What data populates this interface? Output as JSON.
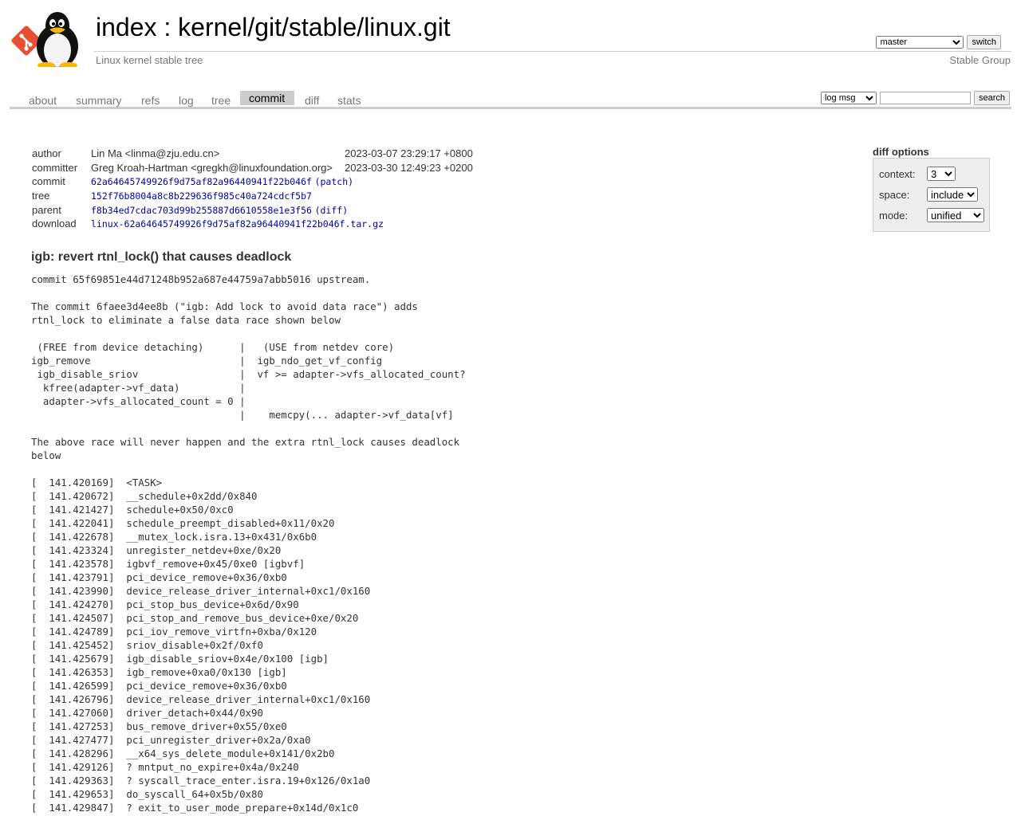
{
  "header": {
    "title_index": "index",
    "title_sep": ":",
    "title_repo": "kernel/git/stable/linux.git",
    "description": "Linux kernel stable tree",
    "owner": "Stable Group",
    "branch_options": [
      "master"
    ],
    "branch_selected": "master",
    "switch_label": "switch"
  },
  "tabs": [
    {
      "label": "about"
    },
    {
      "label": "summary"
    },
    {
      "label": "refs"
    },
    {
      "label": "log"
    },
    {
      "label": "tree"
    },
    {
      "label": "commit",
      "active": true
    },
    {
      "label": "diff"
    },
    {
      "label": "stats"
    }
  ],
  "search": {
    "mode_options": [
      "log msg"
    ],
    "mode_selected": "log msg",
    "query": "",
    "button_label": "search"
  },
  "commit_info": {
    "author_label": "author",
    "author": "Lin Ma <linma@zju.edu.cn>",
    "author_date": "2023-03-07 23:29:17 +0800",
    "committer_label": "committer",
    "committer": "Greg Kroah-Hartman <gregkh@linuxfoundation.org>",
    "committer_date": "2023-03-30 12:49:23 +0200",
    "commit_label": "commit",
    "commit_sha": "62a64645749926f9d75af82a96440941f22b046f",
    "commit_extra": "(patch)",
    "tree_label": "tree",
    "tree_sha": "152f76b8004a8c8b229636f985c40a724cdcf5b7",
    "parent_label": "parent",
    "parent_sha": "f8b34ed7cdac703d99b255887d6610558e1e3f56",
    "parent_extra": "(diff)",
    "download_label": "download",
    "download_file": "linux-62a64645749926f9d75af82a96440941f22b046f.tar.gz"
  },
  "diff_options": {
    "title": "diff options",
    "context_label": "context:",
    "context_value": "3",
    "space_label": "space:",
    "space_value": "include",
    "mode_label": "mode:",
    "mode_value": "unified"
  },
  "message": {
    "subject": "igb: revert rtnl_lock() that causes deadlock",
    "body": "commit 65f69851e44d71248b952a687e44759a7abb5016 upstream.\n\nThe commit 6faee3d4ee8b (\"igb: Add lock to avoid data race\") adds\nrtnl_lock to eliminate a false data race shown below\n\n (FREE from device detaching)      |   (USE from netdev core)\nigb_remove                         |  igb_ndo_get_vf_config\n igb_disable_sriov                 |  vf >= adapter->vfs_allocated_count?\n  kfree(adapter->vf_data)          |\n  adapter->vfs_allocated_count = 0 |\n                                   |    memcpy(... adapter->vf_data[vf]\n\nThe above race will never happen and the extra rtnl_lock causes deadlock\nbelow\n\n[  141.420169]  <TASK>\n[  141.420672]  __schedule+0x2dd/0x840\n[  141.421427]  schedule+0x50/0xc0\n[  141.422041]  schedule_preempt_disabled+0x11/0x20\n[  141.422678]  __mutex_lock.isra.13+0x431/0x6b0\n[  141.423324]  unregister_netdev+0xe/0x20\n[  141.423578]  igbvf_remove+0x45/0xe0 [igbvf]\n[  141.423791]  pci_device_remove+0x36/0xb0\n[  141.423990]  device_release_driver_internal+0xc1/0x160\n[  141.424270]  pci_stop_bus_device+0x6d/0x90\n[  141.424507]  pci_stop_and_remove_bus_device+0xe/0x20\n[  141.424789]  pci_iov_remove_virtfn+0xba/0x120\n[  141.425452]  sriov_disable+0x2f/0xf0\n[  141.425679]  igb_disable_sriov+0x4e/0x100 [igb]\n[  141.426353]  igb_remove+0xa0/0x130 [igb]\n[  141.426599]  pci_device_remove+0x36/0xb0\n[  141.426796]  device_release_driver_internal+0xc1/0x160\n[  141.427060]  driver_detach+0x44/0x90\n[  141.427253]  bus_remove_driver+0x55/0xe0\n[  141.427477]  pci_unregister_driver+0x2a/0xa0\n[  141.428296]  __x64_sys_delete_module+0x141/0x2b0\n[  141.429126]  ? mntput_no_expire+0x4a/0x240\n[  141.429363]  ? syscall_trace_enter.isra.19+0x126/0x1a0\n[  141.429653]  do_syscall_64+0x5b/0x80\n[  141.429847]  ? exit_to_user_mode_prepare+0x14d/0x1c0"
  },
  "colors": {
    "link": "#0000aa",
    "tab_active_bg": "#cccccc",
    "muted_text": "#777777",
    "git_logo": "#e84e31"
  },
  "icons": {
    "logo": "git-tux-logo"
  }
}
